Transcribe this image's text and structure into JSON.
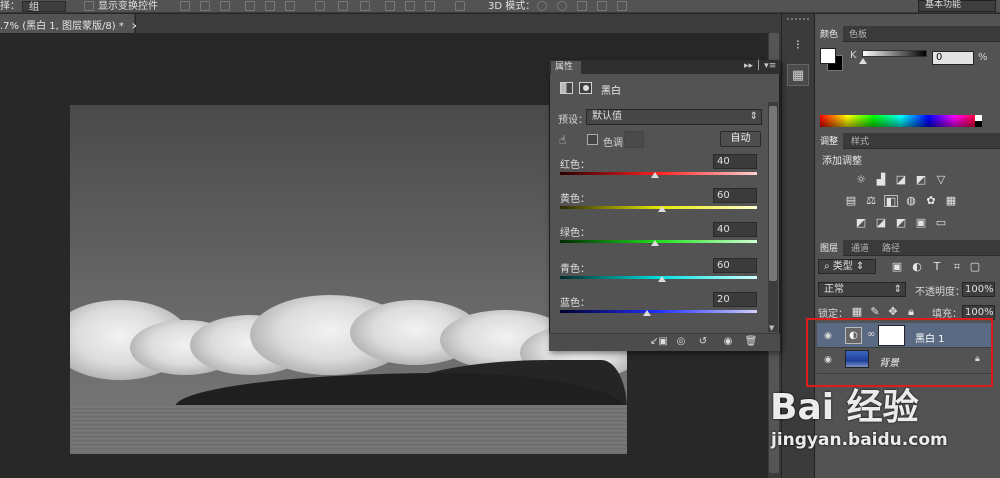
{
  "option_bar": {
    "mode_label": "择：",
    "mode_value": "组",
    "show_transform": "显示变换控件",
    "mode_3d": "3D 模式：",
    "workspace": "基本功能"
  },
  "document_tab": {
    "title": ".7% (黑白 1, 图层蒙版/8) *",
    "close": "×"
  },
  "properties": {
    "tab": "属性",
    "adjustment_name": "黑白",
    "preset_label": "预设：",
    "preset_value": "默认值",
    "tint_label": "色调",
    "auto_button": "自动",
    "sliders": [
      {
        "label": "红色：",
        "value": "40",
        "fraction": 0.48,
        "gradient": "linear-gradient(to right,#2a0000,#ff2020,#ffd0d0)"
      },
      {
        "label": "黄色：",
        "value": "60",
        "fraction": 0.52,
        "gradient": "linear-gradient(to right,#2a2a00,#e6e600,#ffffd0)"
      },
      {
        "label": "绿色：",
        "value": "40",
        "fraction": 0.48,
        "gradient": "linear-gradient(to right,#002a00,#20e020,#d0ffd0)"
      },
      {
        "label": "青色：",
        "value": "60",
        "fraction": 0.52,
        "gradient": "linear-gradient(to right,#002a2a,#00e0e0,#d0ffff)"
      },
      {
        "label": "蓝色：",
        "value": "20",
        "fraction": 0.44,
        "gradient": "linear-gradient(to right,#00002a,#2030ff,#d0d0ff)"
      }
    ]
  },
  "color_panel": {
    "tabs": [
      "颜色",
      "色板"
    ],
    "channel_label": "K",
    "channel_value": "0",
    "percent": "%"
  },
  "adjustments_panel": {
    "tabs": [
      "调整",
      "样式"
    ],
    "title": "添加调整"
  },
  "layers_panel": {
    "tabs": [
      "图层",
      "通道",
      "路径"
    ],
    "filter_label": "类型",
    "blend_mode": "正常",
    "opacity_label": "不透明度：",
    "opacity_value": "100%",
    "lock_label": "锁定：",
    "fill_label": "填充：",
    "fill_value": "100%",
    "layers": [
      {
        "name": "黑白 1",
        "selected": true
      },
      {
        "name": "背景",
        "locked": true
      }
    ]
  },
  "watermark": {
    "brand": "Bai 经验",
    "url": "jingyan.baidu.com"
  },
  "colors": {
    "accent_selected_layer": "#5a6a82",
    "highlight_box": "#d81e1e"
  }
}
